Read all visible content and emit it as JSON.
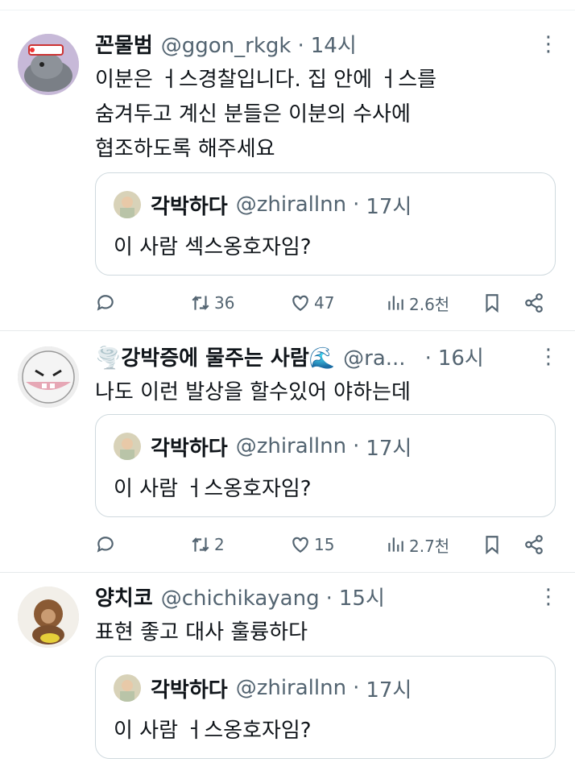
{
  "tweets": [
    {
      "name": "꼰물범",
      "handle": "@ggon_rkgk",
      "time": "14시",
      "text_lines": [
        "이분은 ㅓ스경찰입니다. 집 안에 ㅓ스를",
        "숨겨두고 계신 분들은 이분의 수사에",
        "협조하도록 해주세요"
      ],
      "quote": {
        "name": "각박하다",
        "handle": "@zhirallnn",
        "time": "17시",
        "text": "이 사람 섹스옹호자임?"
      },
      "stats": {
        "replies": "",
        "retweets": "36",
        "likes": "47",
        "views": "2.6천"
      }
    },
    {
      "name": "🌪️강박증에 물주는 사람🌊",
      "handle": "@ra...",
      "time": "16시",
      "text_lines": [
        "나도 이런 발상을 할수있어 야하는데"
      ],
      "quote": {
        "name": "각박하다",
        "handle": "@zhirallnn",
        "time": "17시",
        "text": "이 사람 ㅓ스옹호자임?"
      },
      "stats": {
        "replies": "",
        "retweets": "2",
        "likes": "15",
        "views": "2.7천"
      }
    },
    {
      "name": "양치코",
      "handle": "@chichikayang",
      "time": "15시",
      "text_lines": [
        "표현 좋고 대사 훌륭하다"
      ],
      "quote": {
        "name": "각박하다",
        "handle": "@zhirallnn",
        "time": "17시",
        "text": "이 사람 ㅓ스옹호자임?"
      }
    }
  ],
  "icons": {
    "more": "more-vertical-icon",
    "reply": "reply-icon",
    "retweet": "retweet-icon",
    "like": "heart-icon",
    "views": "views-icon",
    "bookmark": "bookmark-icon",
    "share": "share-icon"
  },
  "colors": {
    "text": "#0f1419",
    "secondary": "#536471",
    "border": "#cfd9de"
  }
}
